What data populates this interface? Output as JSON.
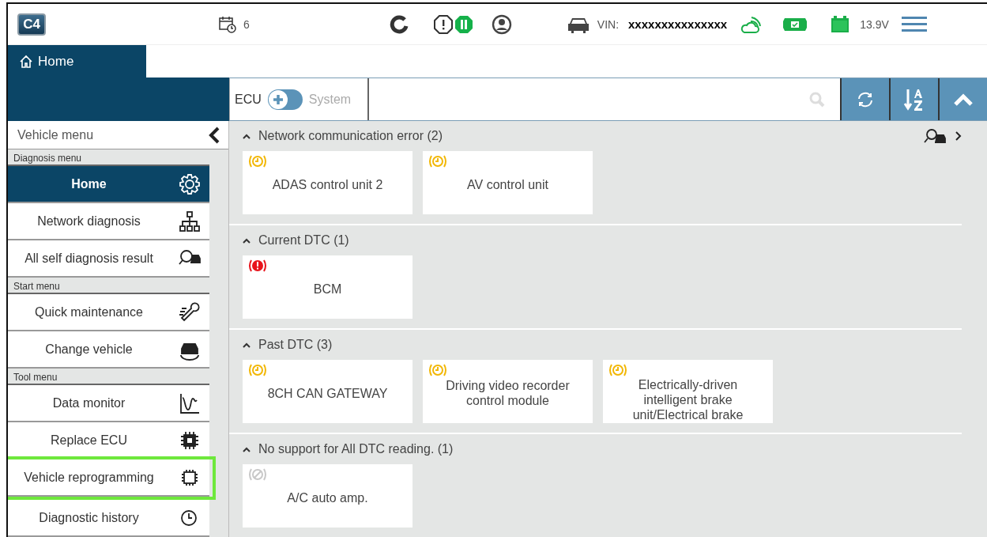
{
  "top_bar": {
    "logo_text": "C4",
    "schedule_count": "6",
    "vin_label": "VIN:",
    "vin": "xxxxxxxxxxxxxxx",
    "voltage": "13.9V"
  },
  "tabs": [
    {
      "label": "Home",
      "selected": true
    }
  ],
  "toolbar": {
    "mode_switch": {
      "off_label": "ECU",
      "on_label": "System",
      "on": false
    }
  },
  "sidebar": {
    "title": "Vehicle menu",
    "groups": [
      {
        "label": "Diagnosis menu",
        "items": [
          {
            "label": "Home",
            "kind": "gear",
            "selected": true,
            "highlighted": false
          },
          {
            "label": "Network diagnosis",
            "kind": "network",
            "selected": false,
            "highlighted": false
          },
          {
            "label": "All self diagnosis result",
            "kind": "diagnosis",
            "selected": false,
            "highlighted": false
          }
        ]
      },
      {
        "label": "Start menu",
        "items": [
          {
            "label": "Quick maintenance",
            "kind": "maintenance",
            "selected": false,
            "highlighted": false
          },
          {
            "label": "Change vehicle",
            "kind": "vehicle",
            "selected": false,
            "highlighted": false
          }
        ]
      },
      {
        "label": "Tool menu",
        "items": [
          {
            "label": "Data monitor",
            "kind": "monitor",
            "selected": false,
            "highlighted": false
          },
          {
            "label": "Replace ECU",
            "kind": "replace",
            "selected": false,
            "highlighted": false
          },
          {
            "label": "Vehicle reprogramming",
            "kind": "reprogram",
            "selected": false,
            "highlighted": true
          },
          {
            "label": "Diagnostic history",
            "kind": "history",
            "selected": false,
            "highlighted": false
          }
        ]
      }
    ]
  },
  "sections": [
    {
      "title": "Network communication error (2)",
      "expanded": true,
      "has_detail_link": true,
      "cards": [
        {
          "label": "ADAS control unit 2",
          "kind": "past"
        },
        {
          "label": "AV control unit",
          "kind": "past"
        }
      ]
    },
    {
      "title": "Current DTC (1)",
      "expanded": true,
      "has_detail_link": false,
      "cards": [
        {
          "label": "BCM",
          "kind": "current"
        }
      ]
    },
    {
      "title": "Past DTC (3)",
      "expanded": true,
      "has_detail_link": false,
      "cards": [
        {
          "label": "8CH CAN GATEWAY",
          "kind": "past"
        },
        {
          "label": "Driving video recorder control module",
          "kind": "past"
        },
        {
          "label": "Electrically-driven intelligent brake unit/Electrical brake",
          "kind": "past"
        }
      ]
    },
    {
      "title": "No support for All DTC reading. (1)",
      "expanded": true,
      "has_detail_link": false,
      "cards": [
        {
          "label": "A/C auto amp.",
          "kind": "unsupported"
        }
      ]
    }
  ]
}
